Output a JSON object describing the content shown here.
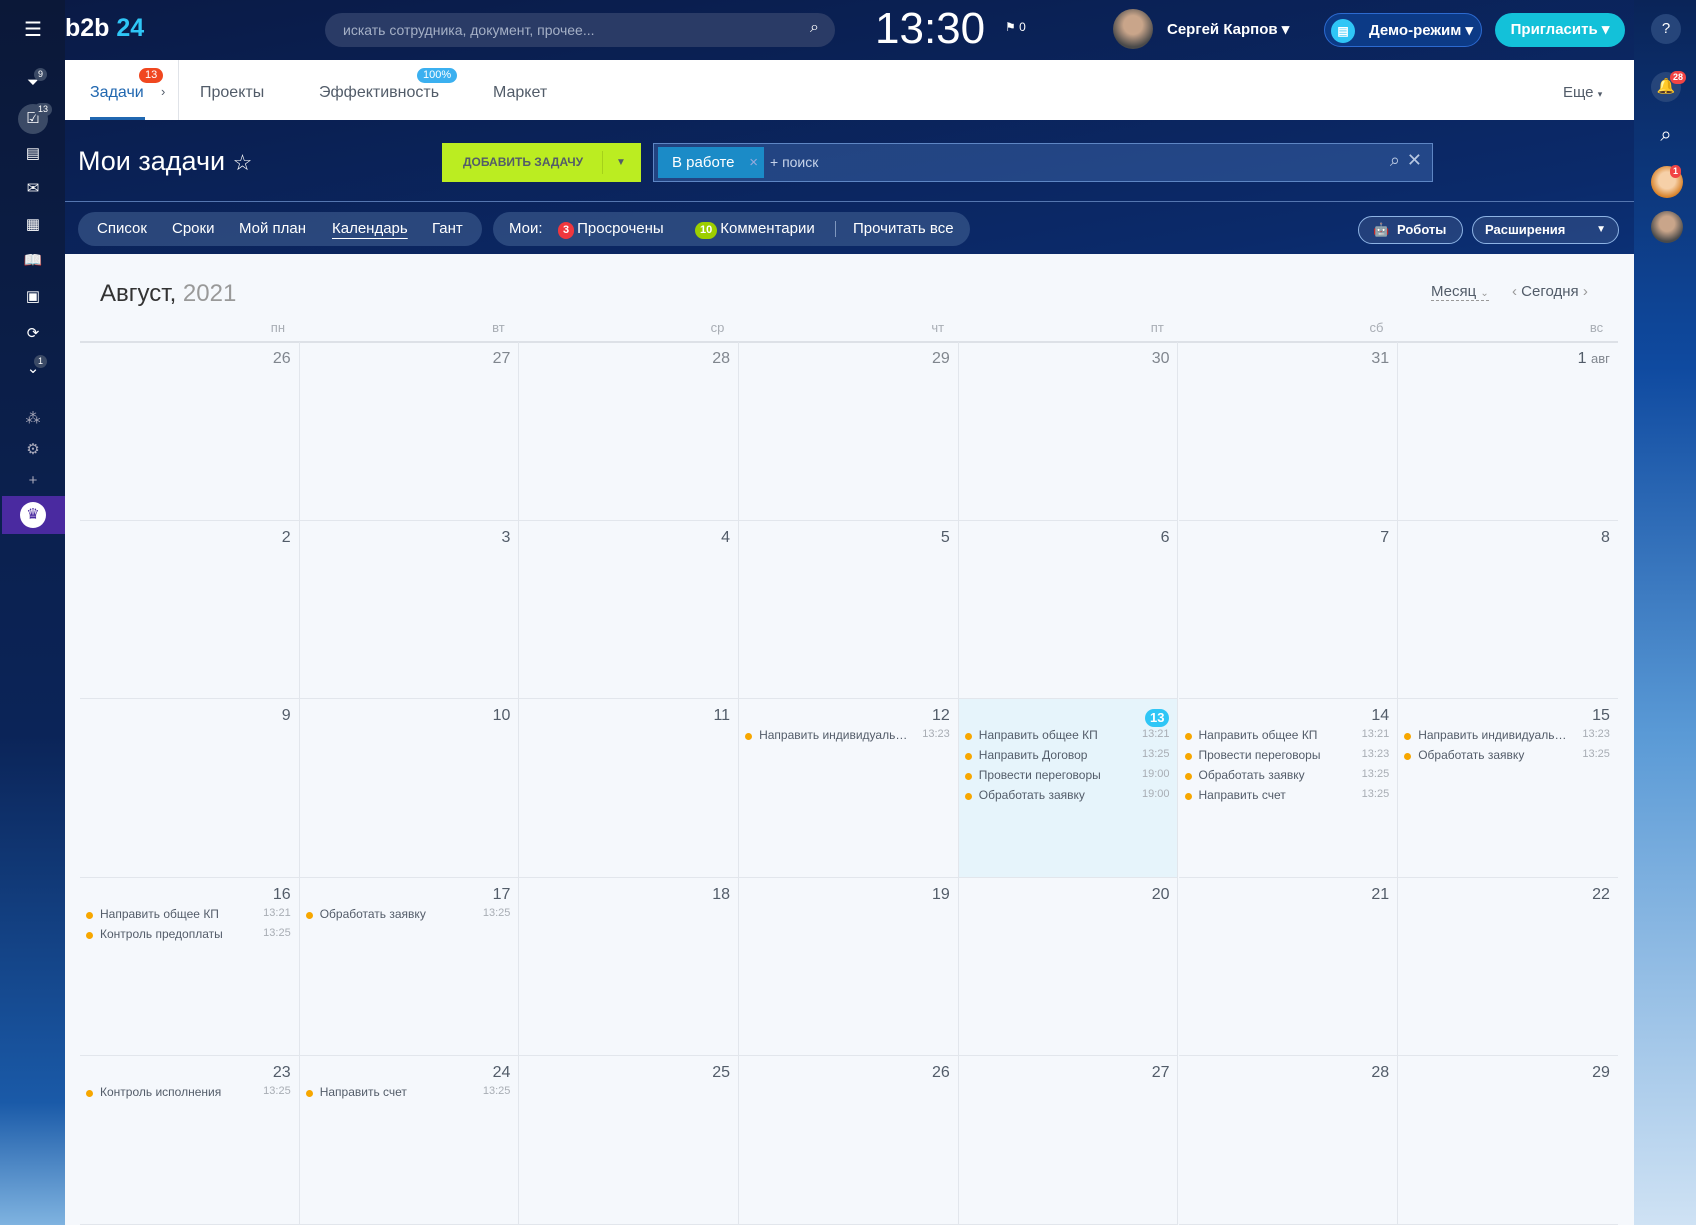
{
  "app": {
    "logo_a": "b2b",
    "logo_b": "24",
    "search_placeholder": "искать сотрудника, документ, прочее...",
    "clock": "13:30",
    "flag_count": "0",
    "user_name": "Сергей Карпов",
    "demo_label": "Демо-режим",
    "invite_label": "Пригласить"
  },
  "left_sidebar": {
    "badges": {
      "filter": "9",
      "tasks": "13",
      "down": "1"
    }
  },
  "right_sidebar": {
    "notifications": "28",
    "avatar_badge": "1"
  },
  "tabs": {
    "items": [
      {
        "label": "Задачи",
        "badge": "13"
      },
      {
        "label": "Проекты"
      },
      {
        "label": "Эффективность",
        "badge": "100%"
      },
      {
        "label": "Маркет"
      }
    ],
    "more": "Еще"
  },
  "page": {
    "title": "Мои задачи",
    "add_task": "ДОБАВИТЬ ЗАДАЧУ",
    "filter_chip": "В работе",
    "filter_placeholder": "+ поиск"
  },
  "views": [
    "Список",
    "Сроки",
    "Мой план",
    "Календарь",
    "Гант"
  ],
  "counters": {
    "label": "Мои:",
    "overdue_count": "3",
    "overdue": "Просрочены",
    "comments_count": "10",
    "comments": "Комментарии",
    "read_all": "Прочитать все"
  },
  "actions": {
    "robots": "Роботы",
    "extensions": "Расширения"
  },
  "calendar": {
    "month": "Август,",
    "year": "2021",
    "view": "Месяц",
    "today": "Сегодня",
    "day_names": [
      "пн",
      "вт",
      "ср",
      "чт",
      "пт",
      "сб",
      "вс"
    ],
    "weeks": [
      [
        {
          "d": "26",
          "m": true
        },
        {
          "d": "27",
          "m": true
        },
        {
          "d": "28",
          "m": true
        },
        {
          "d": "29",
          "m": true
        },
        {
          "d": "30",
          "m": true
        },
        {
          "d": "31",
          "m": true
        },
        {
          "d": "1",
          "mn": "авг"
        }
      ],
      [
        {
          "d": "2"
        },
        {
          "d": "3"
        },
        {
          "d": "4"
        },
        {
          "d": "5"
        },
        {
          "d": "6"
        },
        {
          "d": "7"
        },
        {
          "d": "8"
        }
      ],
      [
        {
          "d": "9"
        },
        {
          "d": "10"
        },
        {
          "d": "11"
        },
        {
          "d": "12",
          "ev": [
            [
              "Направить индивидуальное КП",
              "13:23"
            ]
          ]
        },
        {
          "d": "13",
          "today": true,
          "ev": [
            [
              "Направить общее КП",
              "13:21"
            ],
            [
              "Направить Договор",
              "13:25"
            ],
            [
              "Провести переговоры",
              "19:00"
            ],
            [
              "Обработать заявку",
              "19:00"
            ]
          ]
        },
        {
          "d": "14",
          "ev": [
            [
              "Направить общее КП",
              "13:21"
            ],
            [
              "Провести переговоры",
              "13:23"
            ],
            [
              "Обработать заявку",
              "13:25"
            ],
            [
              "Направить счет",
              "13:25"
            ]
          ]
        },
        {
          "d": "15",
          "ev": [
            [
              "Направить индивидуальное КП",
              "13:23"
            ],
            [
              "Обработать заявку",
              "13:25"
            ]
          ]
        }
      ],
      [
        {
          "d": "16",
          "ev": [
            [
              "Направить общее КП",
              "13:21"
            ],
            [
              "Контроль предоплаты",
              "13:25"
            ]
          ]
        },
        {
          "d": "17",
          "ev": [
            [
              "Обработать заявку",
              "13:25"
            ]
          ]
        },
        {
          "d": "18"
        },
        {
          "d": "19"
        },
        {
          "d": "20"
        },
        {
          "d": "21"
        },
        {
          "d": "22"
        }
      ],
      [
        {
          "d": "23",
          "ev": [
            [
              "Контроль исполнения",
              "13:25"
            ]
          ]
        },
        {
          "d": "24",
          "ev": [
            [
              "Направить счет",
              "13:25"
            ]
          ]
        },
        {
          "d": "25"
        },
        {
          "d": "26"
        },
        {
          "d": "27"
        },
        {
          "d": "28"
        },
        {
          "d": "29"
        }
      ]
    ]
  }
}
